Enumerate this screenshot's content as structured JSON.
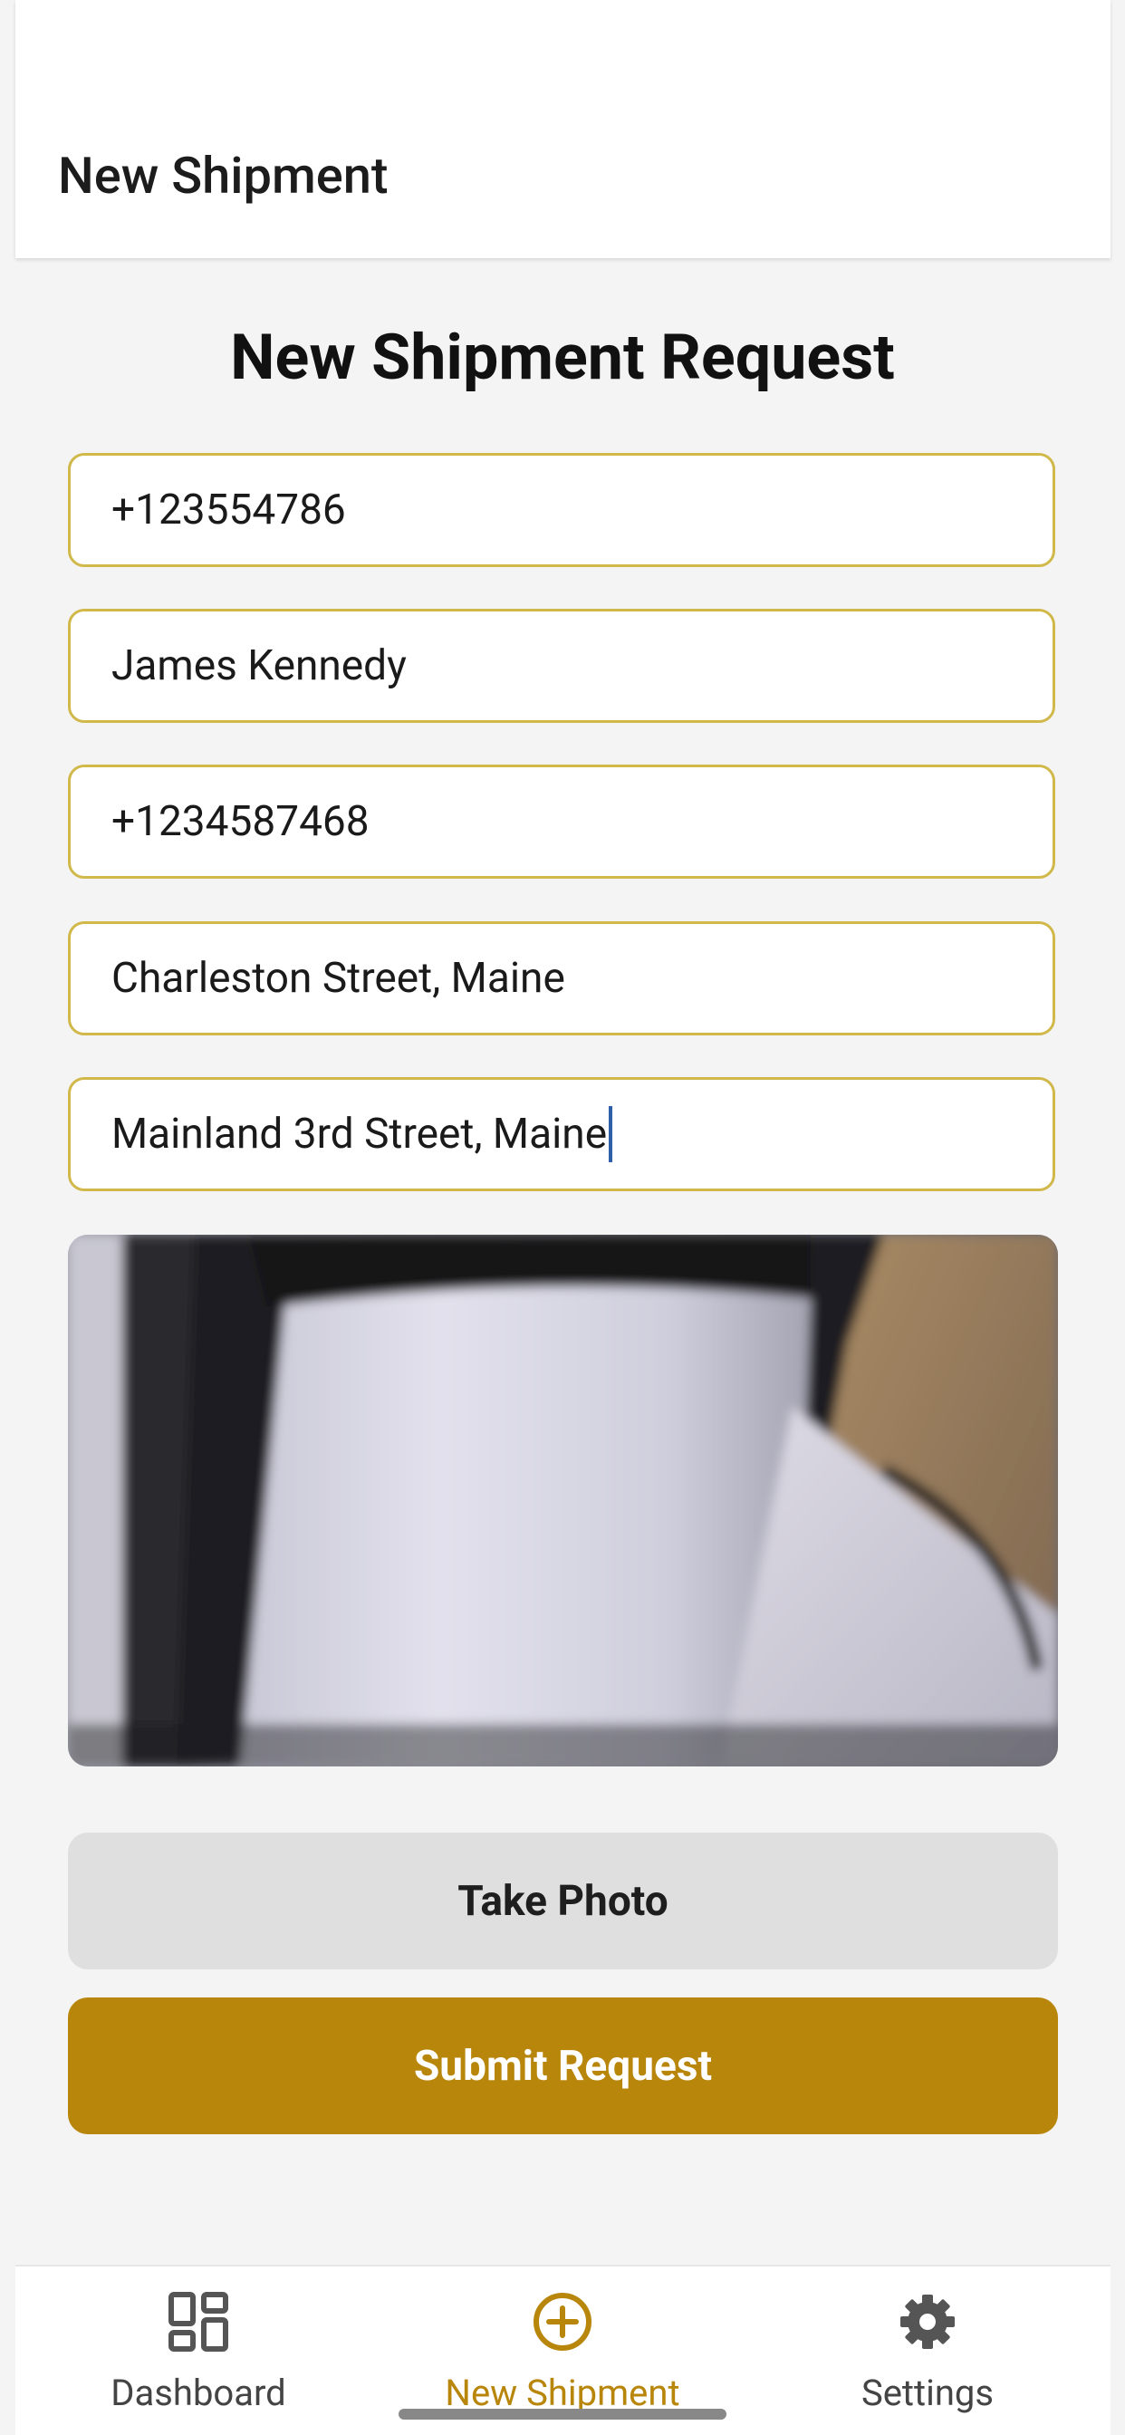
{
  "header": {
    "title": "New Shipment"
  },
  "form": {
    "title": "New Shipment Request",
    "fields": [
      {
        "value": "+123554786"
      },
      {
        "value": "James Kennedy"
      },
      {
        "value": "+1234587468"
      },
      {
        "value": "Charleston Street, Maine"
      },
      {
        "value": "Mainland 3rd Street, Maine"
      }
    ],
    "take_photo_label": "Take Photo",
    "submit_label": "Submit Request"
  },
  "nav": {
    "items": [
      {
        "label": "Dashboard",
        "icon": "dashboard-icon"
      },
      {
        "label": "New Shipment",
        "icon": "plus-circle-icon",
        "active": true
      },
      {
        "label": "Settings",
        "icon": "gear-icon"
      }
    ]
  },
  "colors": {
    "accent": "#b8860b",
    "field_border": "#d1b84a",
    "background": "#f4f4f4"
  }
}
